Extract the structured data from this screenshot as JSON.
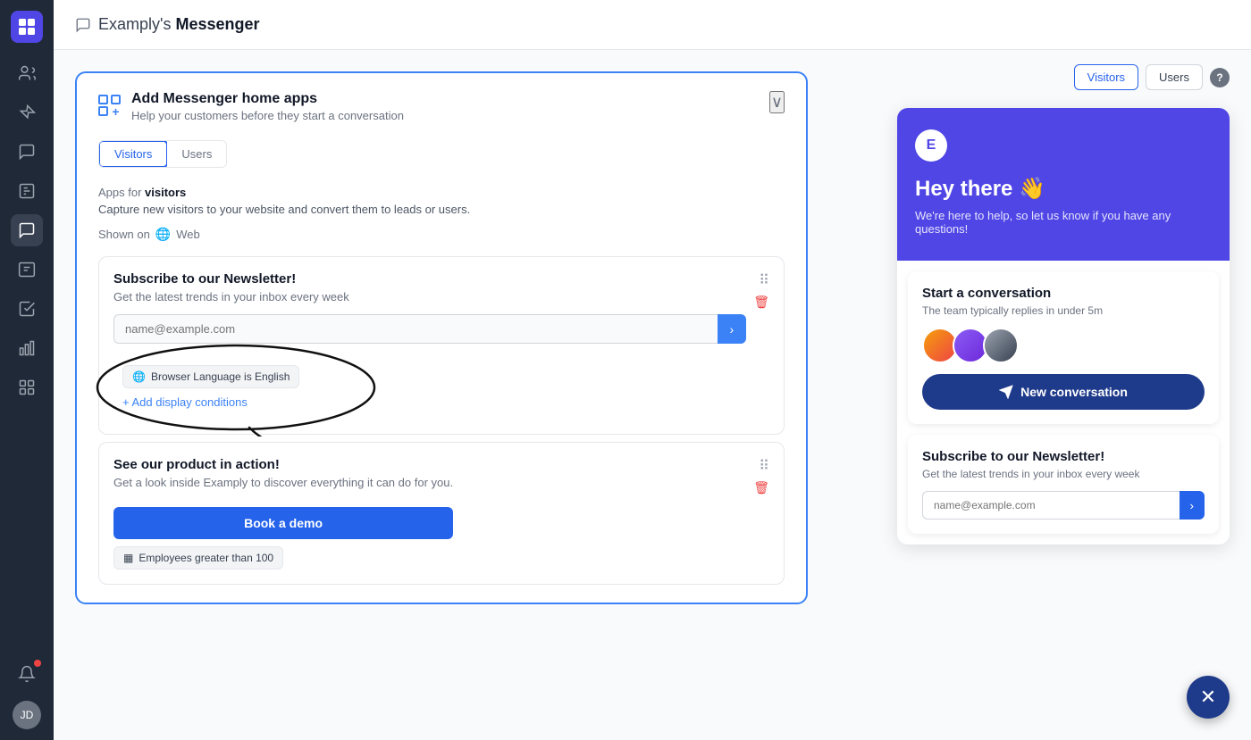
{
  "topbar": {
    "icon": "💬",
    "brand": "Examply's",
    "title": "Messenger"
  },
  "sidebar": {
    "items": [
      {
        "id": "users",
        "icon": "👥",
        "active": false
      },
      {
        "id": "campaigns",
        "icon": "🎯",
        "active": false
      },
      {
        "id": "conversations",
        "icon": "💬",
        "active": true
      },
      {
        "id": "reports",
        "icon": "📋",
        "active": false
      },
      {
        "id": "inbox",
        "icon": "💬",
        "active": false
      },
      {
        "id": "contacts",
        "icon": "📒",
        "active": false
      },
      {
        "id": "analytics",
        "icon": "📊",
        "active": false
      },
      {
        "id": "apps",
        "icon": "⊞",
        "active": false
      }
    ],
    "notifications_icon": "🔔",
    "avatar_initials": "JD"
  },
  "card": {
    "title": "Add Messenger home apps",
    "subtitle": "Help your customers before they start a conversation",
    "tabs": [
      {
        "label": "Visitors",
        "active": true
      },
      {
        "label": "Users",
        "active": false
      }
    ],
    "apps_label": "Apps for",
    "apps_audience": "visitors",
    "apps_desc": "Capture new visitors to your website and convert them to leads or users.",
    "shown_on_label": "Shown on",
    "shown_on_platform": "Web"
  },
  "newsletter_app": {
    "title": "Subscribe to our Newsletter!",
    "desc": "Get the latest trends in your inbox every week",
    "email_placeholder": "name@example.com",
    "email_submit_icon": "›",
    "condition": "Browser Language is English",
    "add_condition_label": "+ Add display conditions"
  },
  "demo_app": {
    "title": "See our product in action!",
    "desc": "Get a look inside Examply to discover everything it can do for you.",
    "cta_label": "Book a demo",
    "condition": "Employees greater than 100"
  },
  "preview": {
    "tabs": [
      {
        "label": "Visitors",
        "active": true
      },
      {
        "label": "Users",
        "active": false
      }
    ],
    "help_label": "?",
    "messenger": {
      "greeting": "Hey there 👋",
      "subtext": "We're here to help, so let us know if you have any questions!",
      "start_conv_title": "Start a conversation",
      "start_conv_desc": "The team typically replies in under 5m",
      "new_conv_label": "New conversation",
      "newsletter_title": "Subscribe to our Newsletter!",
      "newsletter_desc": "Get the latest trends in your inbox every week",
      "newsletter_placeholder": "name@example.com"
    }
  }
}
